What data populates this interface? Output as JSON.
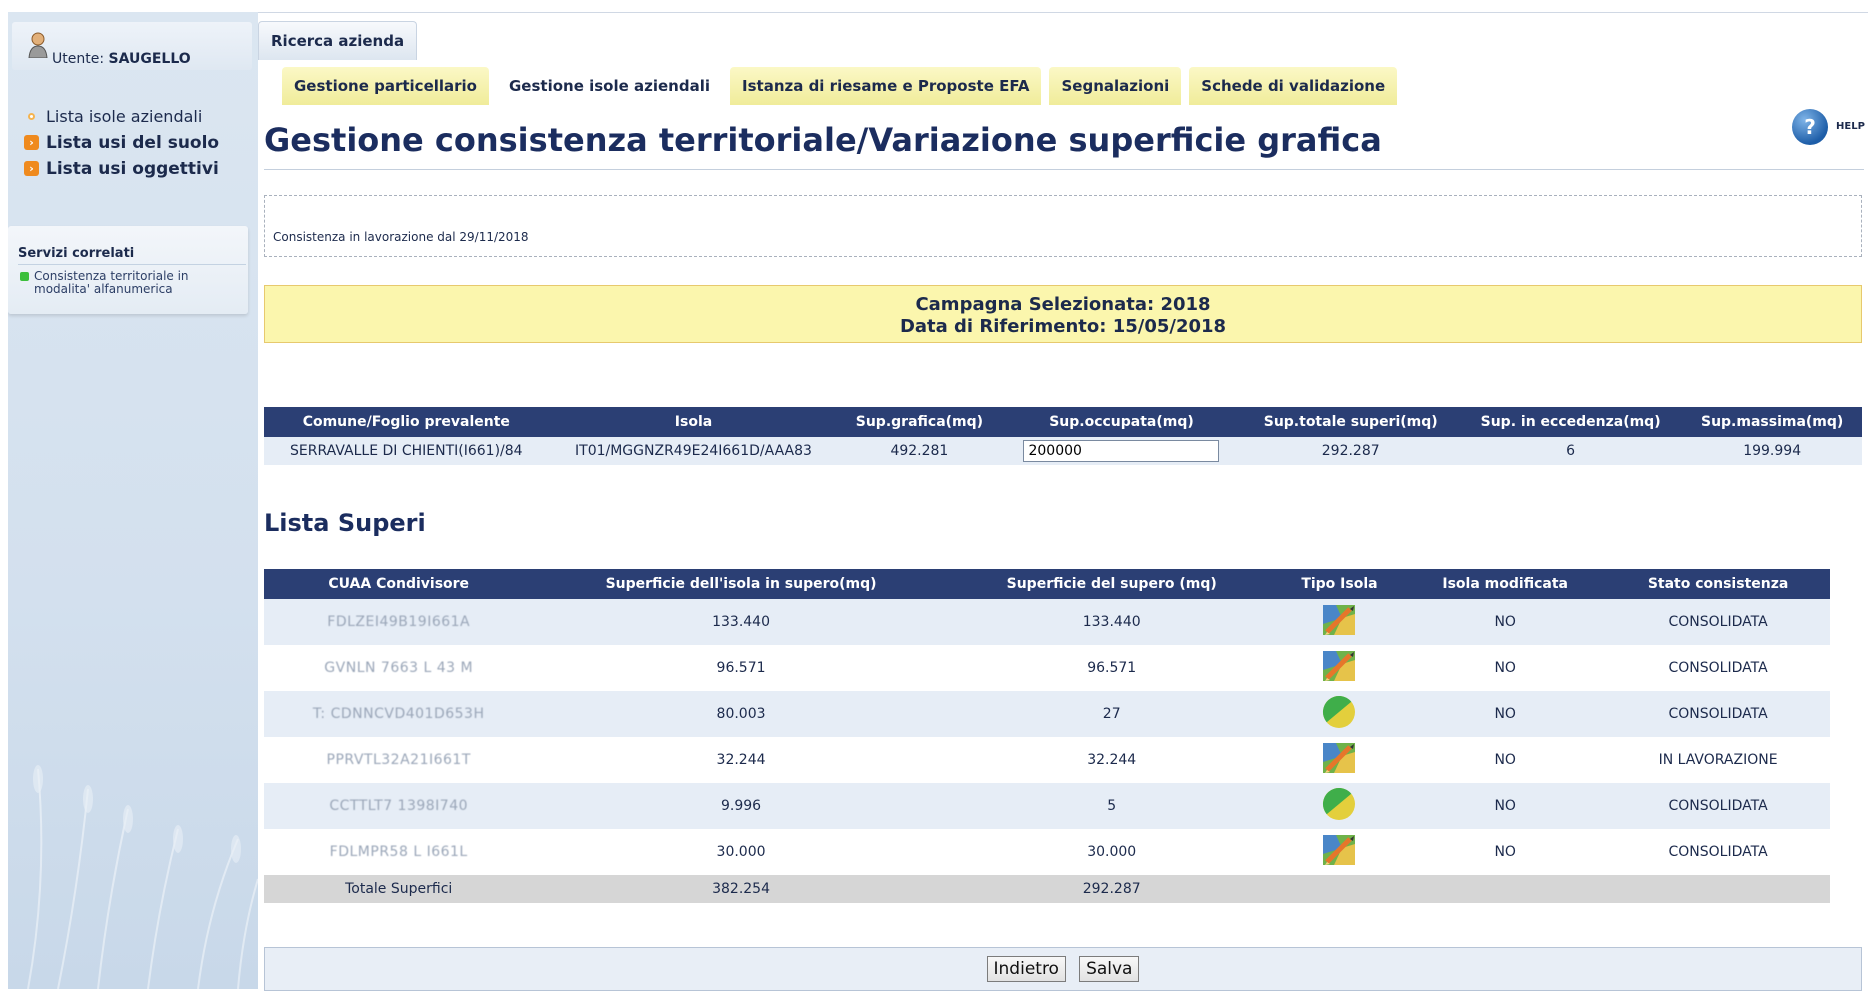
{
  "sidebar": {
    "user_label": "Utente:",
    "user_name": "SAUGELLO",
    "nav": [
      {
        "label": "Lista isole aziendali",
        "style": "light"
      },
      {
        "label": "Lista usi del suolo",
        "style": "bold"
      },
      {
        "label": "Lista usi oggettivi",
        "style": "bold"
      }
    ],
    "servizi_title": "Servizi correlati",
    "servizi_link_line1": "Consistenza territoriale in",
    "servizi_link_line2": "modalita' alfanumerica"
  },
  "tabs": {
    "top": "Ricerca azienda",
    "sub": [
      "Gestione particellario",
      "Gestione isole aziendali",
      "Istanza di riesame e Proposte EFA",
      "Segnalazioni",
      "Schede di validazione"
    ],
    "active_index": 1
  },
  "help_label": "HELP",
  "page_title": "Gestione consistenza territoriale/Variazione superficie grafica",
  "notice": "Consistenza in lavorazione dal 29/11/2018",
  "campaign": {
    "line1": "Campagna Selezionata: 2018",
    "line2": "Data di Riferimento: 15/05/2018"
  },
  "summary_table": {
    "headers": [
      "Comune/Foglio prevalente",
      "Isola",
      "Sup.grafica(mq)",
      "Sup.occupata(mq)",
      "Sup.totale superi(mq)",
      "Sup. in eccedenza(mq)",
      "Sup.massima(mq)"
    ],
    "row": {
      "comune": "SERRAVALLE DI CHIENTI(I661)/84",
      "isola": "IT01/MGGNZR49E24I661D/AAA83",
      "sup_grafica": "492.281",
      "sup_occupata": "200000",
      "sup_totale_superi": "292.287",
      "sup_eccedenza": "6",
      "sup_massima": "199.994"
    }
  },
  "superi_title": "Lista Superi",
  "superi_table": {
    "headers": [
      "CUAA Condivisore",
      "Superficie dell'isola in supero(mq)",
      "Superficie del supero (mq)",
      "Tipo Isola",
      "Isola modificata",
      "Stato consistenza"
    ],
    "rows": [
      {
        "cuaa": "FDLZEI49B19I661A",
        "sup_isola": "133.440",
        "sup_supero": "133.440",
        "tipo_icon": "map-tool-icon",
        "modificata": "NO",
        "stato": "CONSOLIDATA"
      },
      {
        "cuaa": "GVNLN 7663 L 43 M",
        "sup_isola": "96.571",
        "sup_supero": "96.571",
        "tipo_icon": "map-tool-icon",
        "modificata": "NO",
        "stato": "CONSOLIDATA"
      },
      {
        "cuaa": "T: CDNNCVD401D653H",
        "sup_isola": "80.003",
        "sup_supero": "27",
        "tipo_icon": "pie-circle-icon",
        "modificata": "NO",
        "stato": "CONSOLIDATA"
      },
      {
        "cuaa": "PPRVTL32A21I661T",
        "sup_isola": "32.244",
        "sup_supero": "32.244",
        "tipo_icon": "map-tool-icon",
        "modificata": "NO",
        "stato": "IN LAVORAZIONE"
      },
      {
        "cuaa": "CCTTLT7 1398I740",
        "sup_isola": "9.996",
        "sup_supero": "5",
        "tipo_icon": "pie-circle-icon",
        "modificata": "NO",
        "stato": "CONSOLIDATA"
      },
      {
        "cuaa": "FDLMPR58 L I661L",
        "sup_isola": "30.000",
        "sup_supero": "30.000",
        "tipo_icon": "map-tool-icon",
        "modificata": "NO",
        "stato": "CONSOLIDATA"
      }
    ],
    "total": {
      "label": "Totale Superfici",
      "sup_isola": "382.254",
      "sup_supero": "292.287"
    }
  },
  "buttons": {
    "back": "Indietro",
    "save": "Salva"
  }
}
